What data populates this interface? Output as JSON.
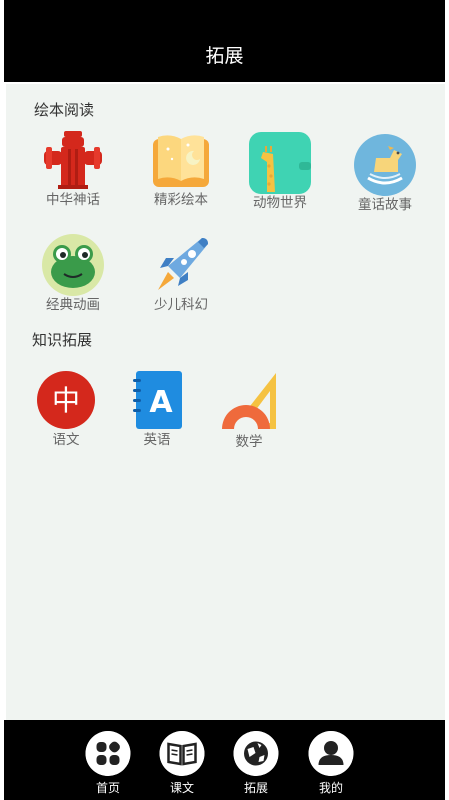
{
  "header": {
    "title": "拓展"
  },
  "picture_book_section": {
    "title": "绘本阅读",
    "items": [
      {
        "label": "中华神话",
        "icon": "fire-hydrant-icon"
      },
      {
        "label": "精彩绘本",
        "icon": "open-book-icon"
      },
      {
        "label": "动物世界",
        "icon": "giraffe-icon"
      },
      {
        "label": "童话故事",
        "icon": "rocking-horse-icon"
      },
      {
        "label": "经典动画",
        "icon": "frog-icon"
      },
      {
        "label": "少儿科幻",
        "icon": "rocket-icon"
      }
    ]
  },
  "knowledge_section": {
    "title": "知识拓展",
    "items": [
      {
        "label": "语文",
        "icon": "chinese-character-icon",
        "glyph": "中"
      },
      {
        "label": "英语",
        "icon": "english-notebook-icon",
        "glyph": "A"
      },
      {
        "label": "数学",
        "icon": "ruler-protractor-icon"
      }
    ]
  },
  "tabbar": {
    "items": [
      {
        "label": "首页",
        "icon": "home-grid-icon"
      },
      {
        "label": "课文",
        "icon": "book-icon"
      },
      {
        "label": "拓展",
        "icon": "globe-icon"
      },
      {
        "label": "我的",
        "icon": "user-icon"
      }
    ]
  },
  "colors": {
    "header_bg": "#000000",
    "content_bg": "#f0f4f1",
    "tabbar_bg": "#000000"
  }
}
